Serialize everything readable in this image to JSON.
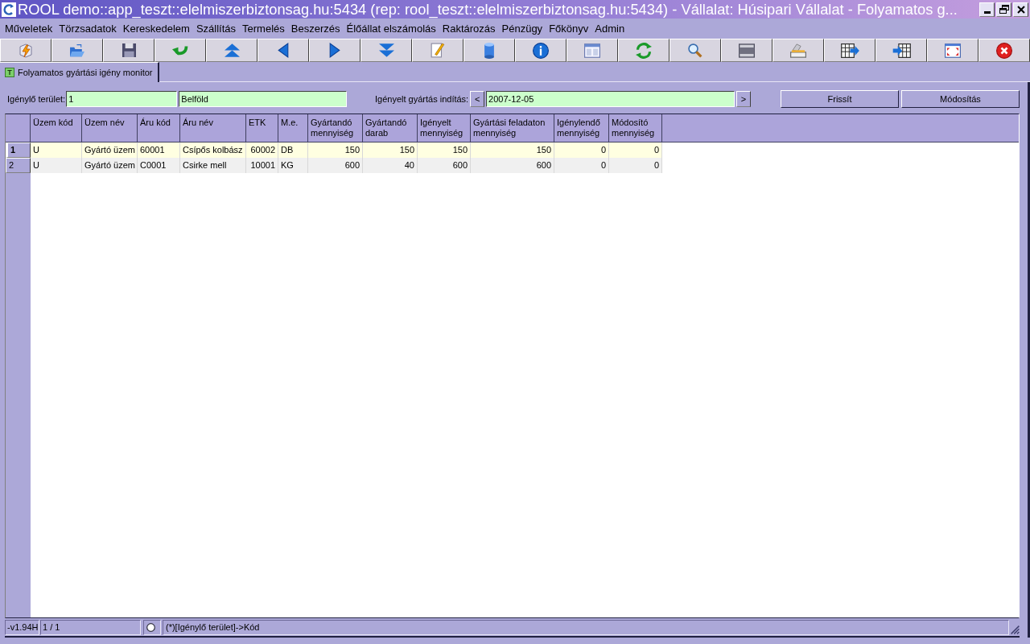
{
  "window": {
    "title": "ROOL demo::app_teszt::elelmiszerbiztonsag.hu:5434 (rep: rool_teszt::elelmiszerbiztonsag.hu:5434) - Vállalat: Húsipari Vállalat - Folyamatos g..."
  },
  "menu": [
    "Műveletek",
    "Törzsadatok",
    "Kereskedelem",
    "Szállítás",
    "Termelés",
    "Beszerzés",
    "Élőállat elszámolás",
    "Raktározás",
    "Pénzügy",
    "Főkönyv",
    "Admin"
  ],
  "tabs": [
    {
      "label": "Folyamatos gyártási igény monitor",
      "icon": "T",
      "selected": true
    }
  ],
  "form": {
    "area_label": "Igénylő terület:",
    "area_code": "1",
    "area_name": "Belföld",
    "start_label": "Igényelt gyártás indítás:",
    "prev": "<",
    "start_date": "2007-12-05",
    "next": ">",
    "buttons": [
      "Frissít",
      "Módosítás"
    ]
  },
  "table": {
    "columns": [
      {
        "label": "Üzem kód",
        "kind": "text"
      },
      {
        "label": "Üzem név",
        "kind": "text"
      },
      {
        "label": "Áru kód",
        "kind": "text"
      },
      {
        "label": "Áru név",
        "kind": "text"
      },
      {
        "label": "ETK",
        "kind": "number"
      },
      {
        "label": "M.e.",
        "kind": "text"
      },
      {
        "label": "Gyártandó mennyiség",
        "kind": "number"
      },
      {
        "label": "Gyártandó darab",
        "kind": "number"
      },
      {
        "label": "Igényelt mennyiség",
        "kind": "number"
      },
      {
        "label": "Gyártási feladaton mennyiség",
        "kind": "number"
      },
      {
        "label": "Igénylendő mennyiség",
        "kind": "number"
      },
      {
        "label": "Módosító mennyiség",
        "kind": "number"
      }
    ],
    "rows": [
      {
        "number": "1",
        "selected": true,
        "cells": [
          "U",
          "Gyártó üzem",
          "60001",
          "Csípős kolbász",
          "60002",
          "DB",
          "150",
          "150",
          "150",
          "150",
          "0",
          "0"
        ]
      },
      {
        "number": "2",
        "selected": false,
        "cells": [
          "U",
          "Gyártó üzem",
          "C0001",
          "Csirke mell",
          "10001",
          "KG",
          "600",
          "40",
          "600",
          "600",
          "0",
          "0"
        ]
      }
    ]
  },
  "status_bar": {
    "version": "-v1.94H",
    "record": "1 / 1",
    "message": "(*)[Igénylő terület]->Kód"
  }
}
